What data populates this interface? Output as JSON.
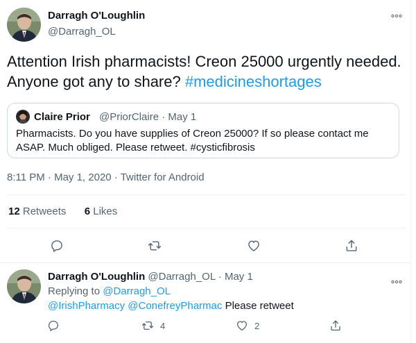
{
  "main_tweet": {
    "display_name": "Darragh O'Loughlin",
    "handle": "@Darragh_OL",
    "text_plain": "Attention Irish pharmacists! Creon 25000 urgently needed. Anyone got any to share?",
    "hashtag": "#medicineshortages",
    "timestamp": "8:11 PM · May 1, 2020 · Twitter for Android",
    "retweets_count": "12",
    "retweets_label": "Retweets",
    "likes_count": "6",
    "likes_label": "Likes"
  },
  "quoted_tweet": {
    "display_name": "Claire Prior",
    "meta": "@PriorClaire · May 1",
    "text": "Pharmacists. Do you have supplies of Creon 25000? If so please contact me ASAP. Much obliged. Please retweet. #cysticfibrosis"
  },
  "reply_tweet": {
    "display_name": "Darragh O'Loughlin",
    "meta": "@Darragh_OL · May 1",
    "replying_prefix": "Replying to",
    "replying_to": "@Darragh_OL",
    "mention_1": "@IrishPharmacy",
    "mention_2": "@ConefreyPharmac",
    "text": "Please retweet",
    "retweet_count": "4",
    "like_count": "2"
  },
  "icons": [
    "reply-icon",
    "retweet-icon",
    "like-icon",
    "share-icon",
    "more-options-icon"
  ],
  "colors": {
    "accent": "#1d9bf0",
    "text": "#0f1419",
    "muted": "#536471",
    "border": "#cfd9de",
    "divider": "#eff3f4"
  }
}
